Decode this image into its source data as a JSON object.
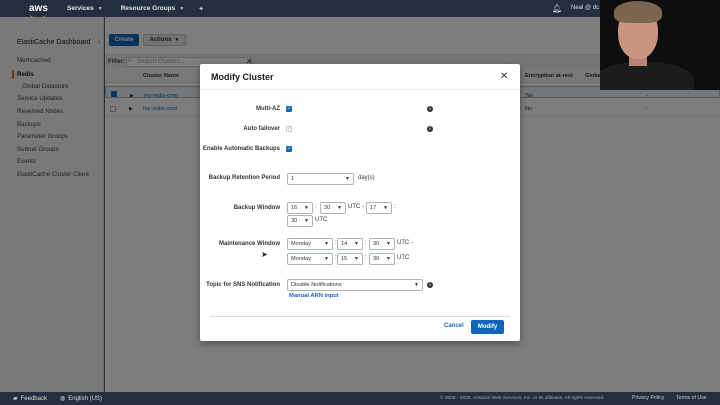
{
  "topnav": {
    "logo": "aws",
    "services": "Services",
    "resource_groups": "Resource Groups",
    "user": "Neal @ dc"
  },
  "sidebar": {
    "title": "ElastiCache Dashboard",
    "items": [
      "Memcached",
      "Redis",
      "Global Datastore",
      "Service Updates",
      "Reserved Nodes",
      "Backups",
      "Parameter Groups",
      "Subnet Groups",
      "Events",
      "ElastiCache Cluster Client"
    ]
  },
  "main": {
    "create_label": "Create",
    "actions_label": "Actions",
    "filter_label": "Filter:",
    "filter_placeholder": "Search Clusters...",
    "columns": {
      "cluster_name": "Cluster Name",
      "encryption_at_rest": "Encryption at-rest",
      "global": "Global"
    },
    "rows": [
      {
        "name": "my-redis-cmo",
        "encryption": "No",
        "global": "-"
      },
      {
        "name": "my-redis-cmd",
        "encryption": "No",
        "global": "-"
      }
    ]
  },
  "modal": {
    "title": "Modify Cluster",
    "multi_az_label": "Multi-AZ",
    "auto_failover_label": "Auto failover",
    "backups_label": "Enable Automatic Backups",
    "retention_label": "Backup Retention Period",
    "retention_value": "1",
    "retention_unit": "day(s)",
    "backup_window_label": "Backup Window",
    "backup_window": {
      "start_hour": "16",
      "start_min": "30",
      "mid_text": "UTC -",
      "end_hour": "17",
      "end_min": "30",
      "utc": "UTC"
    },
    "maintenance_label": "Maintenance Window",
    "maintenance": {
      "start_day": "Monday",
      "start_hour": "14",
      "start_min": "30",
      "start_utc": "UTC -",
      "end_day": "Monday",
      "end_hour": "15",
      "end_min": "30",
      "end_utc": "UTC"
    },
    "sns_label": "Topic for SNS Notification",
    "sns_value": "Disable Notifications",
    "manual_arn": "Manual ARN input",
    "cancel_label": "Cancel",
    "modify_label": "Modify",
    "colon": ":"
  },
  "footer": {
    "feedback": "Feedback",
    "language": "English (US)",
    "copyright": "© 2008 - 2020, Amazon Web Services, Inc. or its affiliates. All rights reserved.",
    "privacy": "Privacy Policy",
    "terms": "Terms of Use"
  },
  "colors": {
    "accent": "#1166bb",
    "nav": "#232f3e",
    "active": "#ec7211"
  },
  "icons": [
    "pin-icon",
    "bell-icon",
    "search-icon",
    "close-icon",
    "info-icon",
    "check-icon",
    "chevron-down-icon",
    "speech-bubble-icon",
    "globe-icon"
  ]
}
